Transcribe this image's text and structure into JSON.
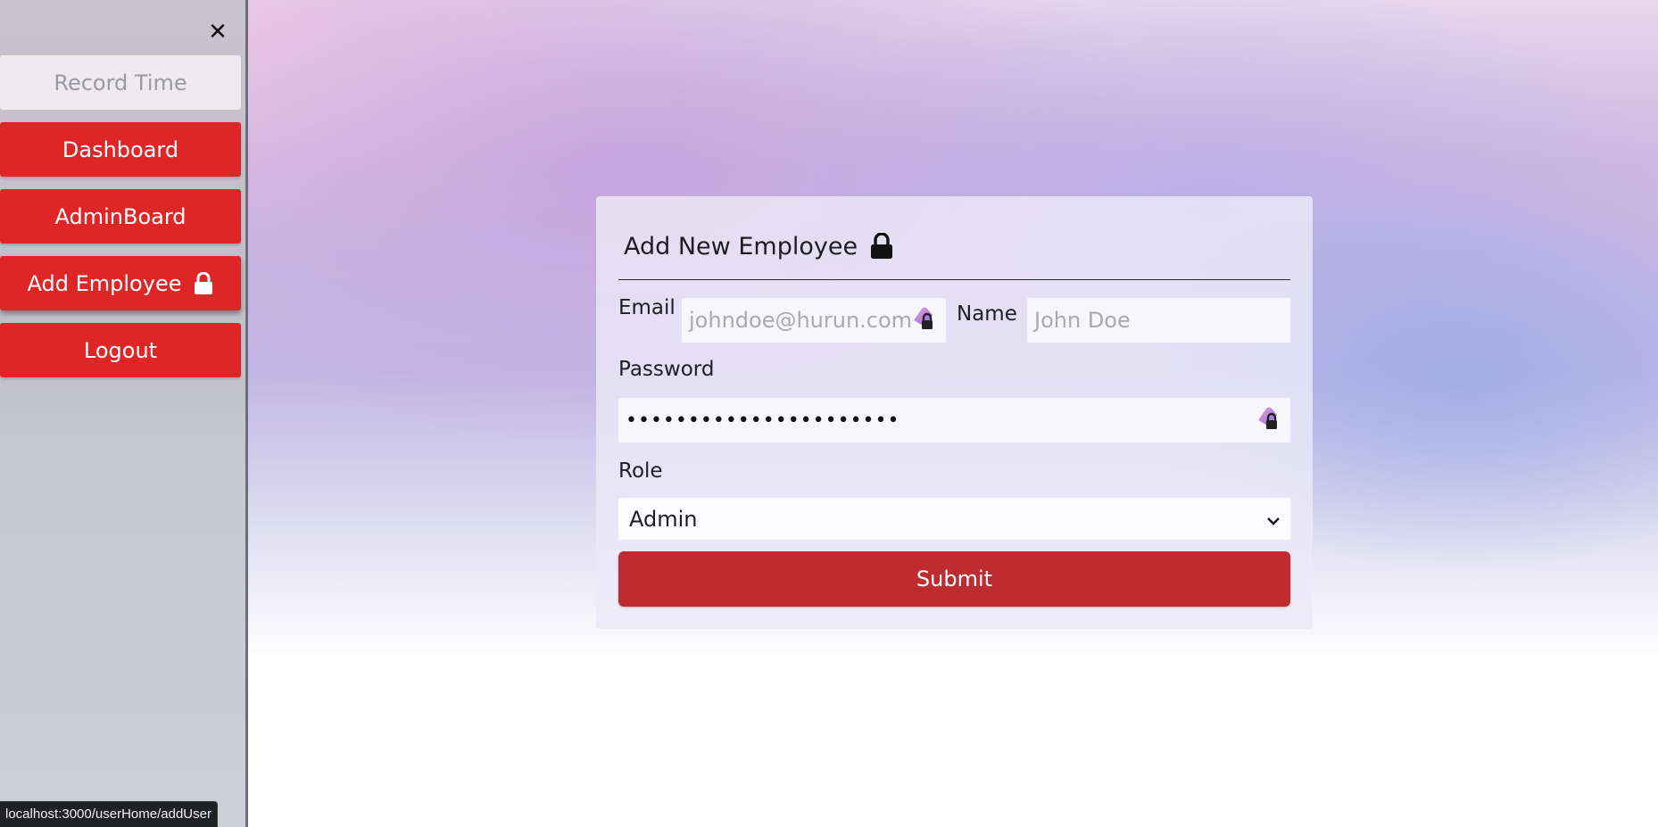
{
  "sidebar": {
    "close_icon": "close-icon",
    "items": [
      {
        "label": "Record Time",
        "state": "disabled"
      },
      {
        "label": "Dashboard"
      },
      {
        "label": "AdminBoard"
      },
      {
        "label": "Add Employee",
        "icon": "lock-icon",
        "state": "active"
      },
      {
        "label": "Logout"
      }
    ]
  },
  "form": {
    "title": "Add New Employee",
    "title_icon": "lock-icon",
    "email": {
      "label": "Email",
      "placeholder": "johndoe@hurun.com",
      "value": ""
    },
    "name": {
      "label": "Name",
      "placeholder": "John Doe",
      "value": ""
    },
    "password": {
      "label": "Password",
      "value_masked": "••••••••••••••••••••••"
    },
    "role": {
      "label": "Role",
      "selected": "Admin"
    },
    "submit_label": "Submit"
  },
  "status_bar": {
    "url": "localhost:3000/userHome/addUser"
  },
  "colors": {
    "nav_button": "#de2626",
    "submit_button": "#be2b31",
    "record_button_bg": "#eeeaf0",
    "record_button_text": "#9a9aa2"
  }
}
